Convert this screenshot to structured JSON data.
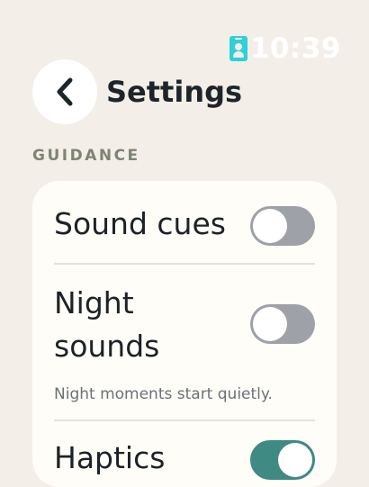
{
  "status_bar": {
    "time": "10:39",
    "badge_icon": "id-badge-icon",
    "badge_color": "#2FD0D8"
  },
  "header": {
    "back_icon": "chevron-left-icon",
    "title": "Settings"
  },
  "section": {
    "label": "GUIDANCE"
  },
  "settings": {
    "sound_cues": {
      "label": "Sound cues",
      "enabled": false
    },
    "night_sounds": {
      "label_line1": "Night",
      "label_line2": "sounds",
      "enabled": false,
      "hint": "Night moments start quietly."
    },
    "third": {
      "label": "Haptics",
      "enabled": true
    }
  },
  "colors": {
    "background": "#F3EFE8",
    "card": "#FEFDF8",
    "toggle_off": "#9EA1A8",
    "toggle_on": "#3F8A82",
    "title": "#1E252A",
    "section_label": "#7E8474"
  }
}
